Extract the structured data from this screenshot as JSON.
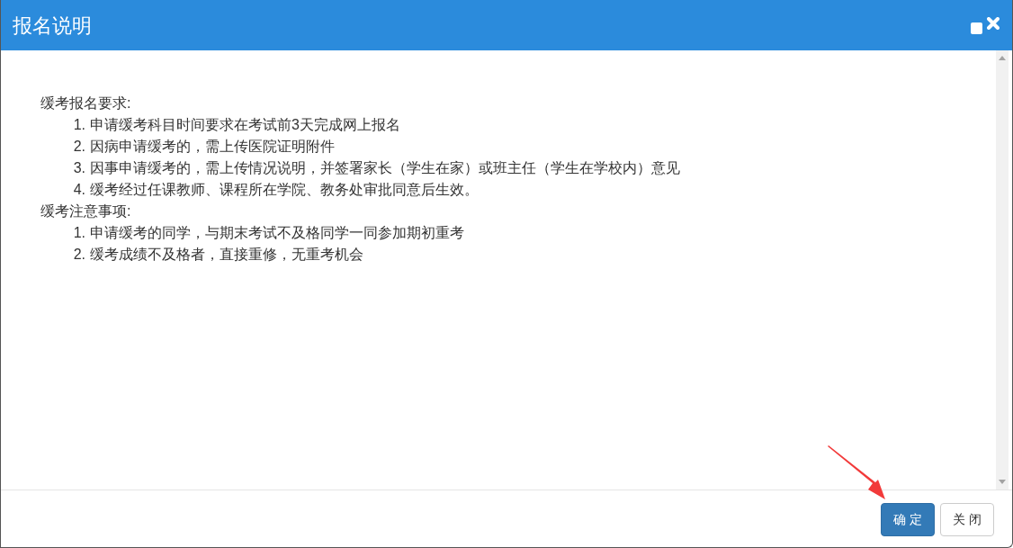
{
  "dialog": {
    "title": "报名说明"
  },
  "sections": [
    {
      "heading": "缓考报名要求:",
      "items": [
        {
          "number": "1.",
          "text": "申请缓考科目时间要求在考试前3天完成网上报名"
        },
        {
          "number": "2.",
          "text": "因病申请缓考的，需上传医院证明附件"
        },
        {
          "number": "3.",
          "text": "因事申请缓考的，需上传情况说明，并签署家长（学生在家）或班主任（学生在学校内）意见"
        },
        {
          "number": "4.",
          "text": "缓考经过任课教师、课程所在学院、教务处审批同意后生效。"
        }
      ]
    },
    {
      "heading": "缓考注意事项:",
      "items": [
        {
          "number": "1.",
          "text": "申请缓考的同学，与期末考试不及格同学一同参加期初重考"
        },
        {
          "number": "2.",
          "text": "缓考成绩不及格者，直接重修，无重考机会"
        }
      ]
    }
  ],
  "buttons": [
    {
      "label": "确 定",
      "kind": "primary"
    },
    {
      "label": "关 闭",
      "kind": "default"
    }
  ]
}
